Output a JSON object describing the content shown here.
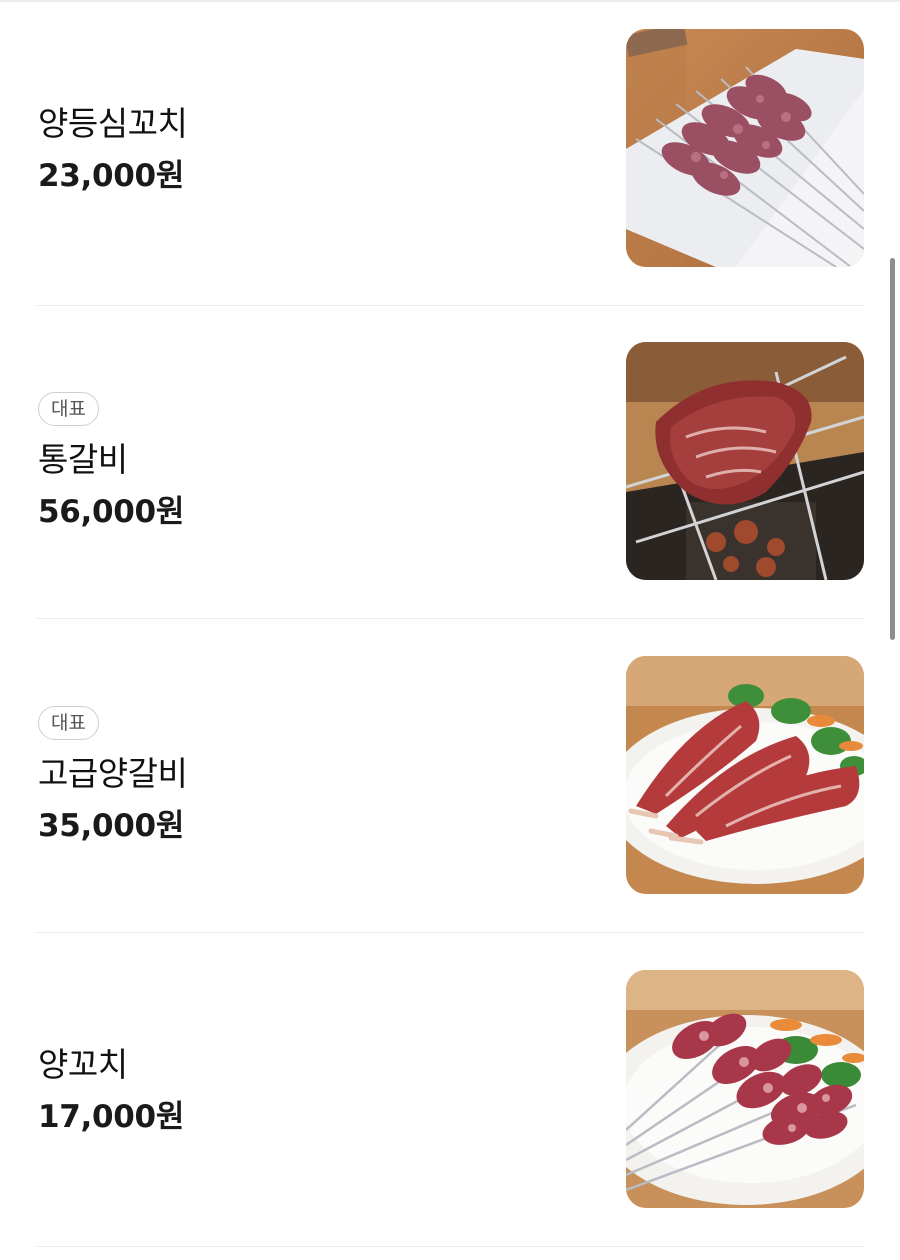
{
  "menu": {
    "items": [
      {
        "name": "양등심꼬치",
        "price": "23,000원",
        "badge": null,
        "image": "lamb-loin-skewers-photo"
      },
      {
        "name": "통갈비",
        "price": "56,000원",
        "badge": "대표",
        "image": "whole-rib-on-grill-photo"
      },
      {
        "name": "고급양갈비",
        "price": "35,000원",
        "badge": "대표",
        "image": "premium-lamb-ribs-photo"
      },
      {
        "name": "양꼬치",
        "price": "17,000원",
        "badge": null,
        "image": "lamb-skewers-photo"
      }
    ]
  },
  "colors": {
    "text": "#111111",
    "badge_border": "#cfcfcf",
    "divider": "#ededed",
    "scrollbar": "#8e8e8e"
  }
}
